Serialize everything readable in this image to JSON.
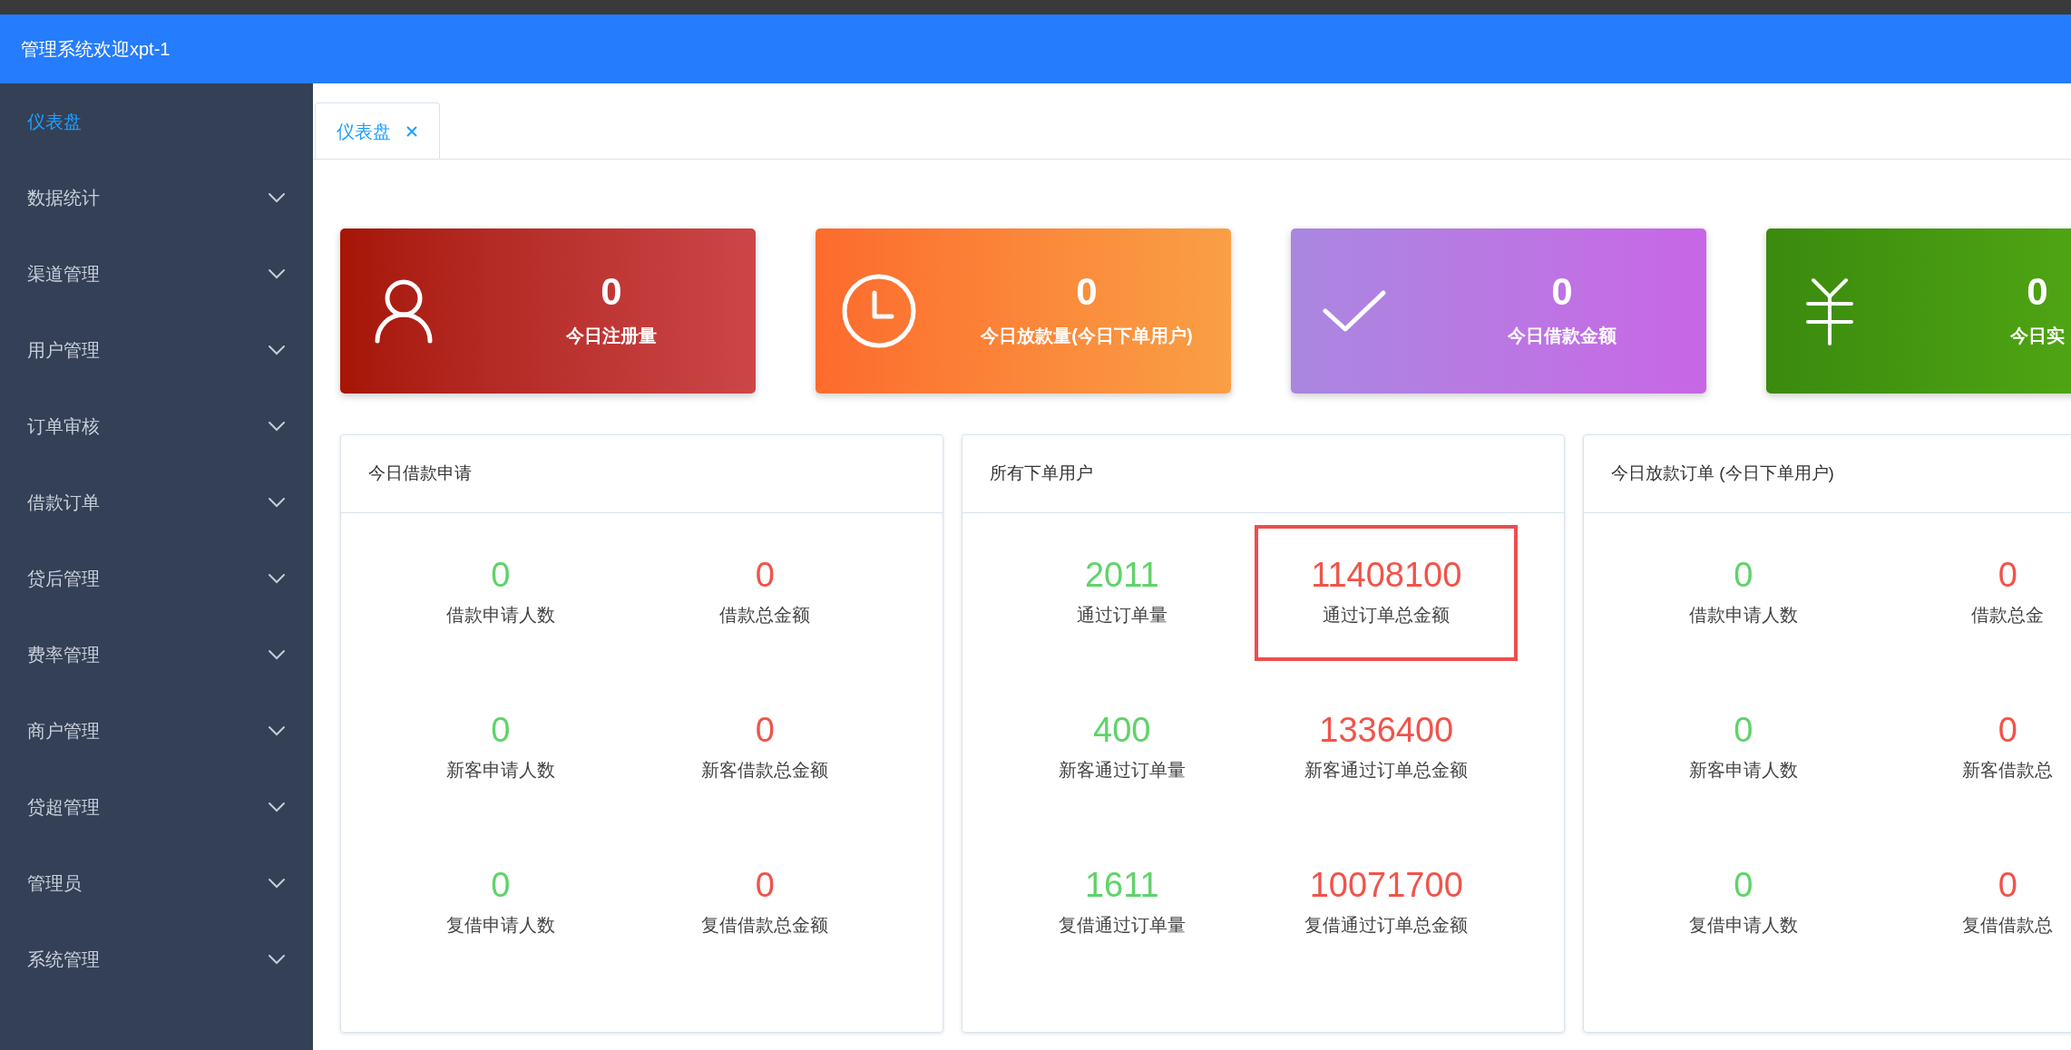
{
  "header": {
    "title": "管理系统欢迎xpt-1"
  },
  "sidebar": {
    "items": [
      {
        "label": "仪表盘",
        "selected": true,
        "expandable": false
      },
      {
        "label": "数据统计",
        "selected": false,
        "expandable": true
      },
      {
        "label": "渠道管理",
        "selected": false,
        "expandable": true
      },
      {
        "label": "用户管理",
        "selected": false,
        "expandable": true
      },
      {
        "label": "订单审核",
        "selected": false,
        "expandable": true
      },
      {
        "label": "借款订单",
        "selected": false,
        "expandable": true
      },
      {
        "label": "贷后管理",
        "selected": false,
        "expandable": true
      },
      {
        "label": "费率管理",
        "selected": false,
        "expandable": true
      },
      {
        "label": "商户管理",
        "selected": false,
        "expandable": true
      },
      {
        "label": "贷超管理",
        "selected": false,
        "expandable": true
      },
      {
        "label": "管理员",
        "selected": false,
        "expandable": true
      },
      {
        "label": "系统管理",
        "selected": false,
        "expandable": true
      }
    ]
  },
  "tabs": [
    {
      "label": "仪表盘",
      "selected": true,
      "closable": true
    }
  ],
  "stat_cards": [
    {
      "kind": "user",
      "value": "0",
      "label": "今日注册量"
    },
    {
      "kind": "clock",
      "value": "0",
      "label": "今日放款量(今日下单用户)"
    },
    {
      "kind": "check",
      "value": "0",
      "label": "今日借款金额"
    },
    {
      "kind": "yen",
      "value": "0",
      "label": "今日实"
    }
  ],
  "panels": [
    {
      "title": "今日借款申请",
      "stats": [
        {
          "value": "0",
          "label": "借款申请人数",
          "color": "#5fd36a",
          "highlighted": false
        },
        {
          "value": "0",
          "label": "借款总金额",
          "color": "#f0544a",
          "highlighted": false
        },
        {
          "value": "0",
          "label": "新客申请人数",
          "color": "#5fd36a",
          "highlighted": false
        },
        {
          "value": "0",
          "label": "新客借款总金额",
          "color": "#f0544a",
          "highlighted": false
        },
        {
          "value": "0",
          "label": "复借申请人数",
          "color": "#5fd36a",
          "highlighted": false
        },
        {
          "value": "0",
          "label": "复借借款总金额",
          "color": "#f0544a",
          "highlighted": false
        }
      ]
    },
    {
      "title": "所有下单用户",
      "stats": [
        {
          "value": "2011",
          "label": "通过订单量",
          "color": "#5fd36a",
          "highlighted": false
        },
        {
          "value": "11408100",
          "label": "通过订单总金额",
          "color": "#f0544a",
          "highlighted": true
        },
        {
          "value": "400",
          "label": "新客通过订单量",
          "color": "#5fd36a",
          "highlighted": false
        },
        {
          "value": "1336400",
          "label": "新客通过订单总金额",
          "color": "#f0544a",
          "highlighted": false
        },
        {
          "value": "1611",
          "label": "复借通过订单量",
          "color": "#5fd36a",
          "highlighted": false
        },
        {
          "value": "10071700",
          "label": "复借通过订单总金额",
          "color": "#f0544a",
          "highlighted": false
        }
      ]
    },
    {
      "title": "今日放款订单 (今日下单用户)",
      "stats": [
        {
          "value": "0",
          "label": "借款申请人数",
          "color": "#5fd36a",
          "highlighted": false
        },
        {
          "value": "0",
          "label": "借款总金",
          "color": "#f0544a",
          "highlighted": false
        },
        {
          "value": "0",
          "label": "新客申请人数",
          "color": "#5fd36a",
          "highlighted": false
        },
        {
          "value": "0",
          "label": "新客借款总",
          "color": "#f0544a",
          "highlighted": false
        },
        {
          "value": "0",
          "label": "复借申请人数",
          "color": "#5fd36a",
          "highlighted": false
        },
        {
          "value": "0",
          "label": "复借借款总",
          "color": "#f0544a",
          "highlighted": false
        }
      ]
    }
  ]
}
